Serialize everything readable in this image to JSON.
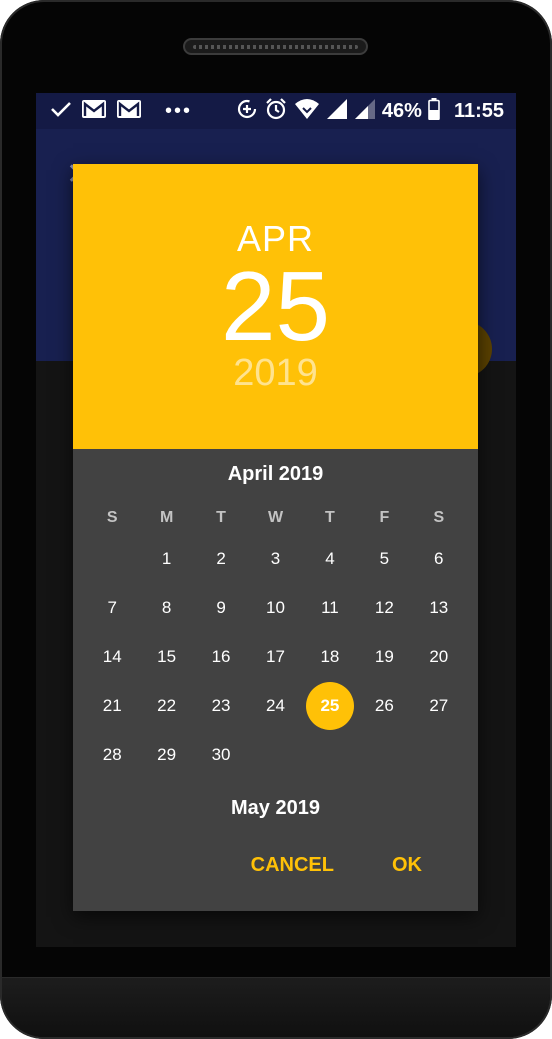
{
  "status_bar": {
    "battery_percent": "46%",
    "time": "11:55",
    "icons": [
      "check-icon",
      "gmail-icon",
      "gmail-icon",
      "more-dots-icon",
      "data-saver-icon",
      "alarm-icon",
      "wifi-icon",
      "signal-icon",
      "signal-icon",
      "battery-icon"
    ]
  },
  "picker": {
    "header": {
      "month": "APR",
      "day": "25",
      "year": "2019"
    },
    "month_title": "April 2019",
    "next_month_title": "May 2019",
    "weekdays": [
      "S",
      "M",
      "T",
      "W",
      "T",
      "F",
      "S"
    ],
    "leading_blanks": 1,
    "days": [
      "1",
      "2",
      "3",
      "4",
      "5",
      "6",
      "7",
      "8",
      "9",
      "10",
      "11",
      "12",
      "13",
      "14",
      "15",
      "16",
      "17",
      "18",
      "19",
      "20",
      "21",
      "22",
      "23",
      "24",
      "25",
      "26",
      "27",
      "28",
      "29",
      "30"
    ],
    "selected_day": "25",
    "cancel_label": "CANCEL",
    "ok_label": "OK"
  },
  "colors": {
    "accent": "#ffc107",
    "dialog_bg": "#424242",
    "app_bar": "#182050",
    "status_bar": "#141a45"
  }
}
